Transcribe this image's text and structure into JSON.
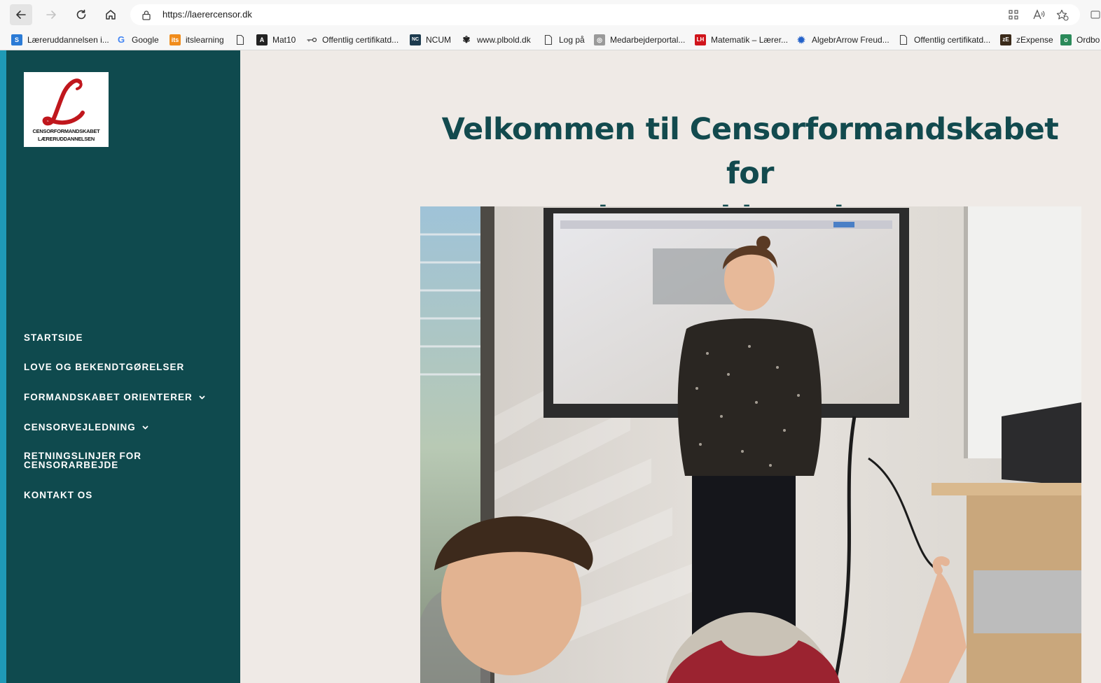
{
  "browser": {
    "url": "https://laerercensor.dk",
    "bookmarks": [
      {
        "label": "Læreruddannelsen i...",
        "icon": "sharepoint-icon"
      },
      {
        "label": "Google",
        "icon": "google-icon"
      },
      {
        "label": "itslearning",
        "icon": "itslearning-icon"
      },
      {
        "label": "",
        "icon": "page-icon"
      },
      {
        "label": "Mat10",
        "icon": "mat10-icon"
      },
      {
        "label": "Offentlig certifikatd...",
        "icon": "key-icon"
      },
      {
        "label": "NCUM",
        "icon": "ncum-icon"
      },
      {
        "label": "www.plbold.dk",
        "icon": "plbold-icon"
      },
      {
        "label": "Log på",
        "icon": "page-icon"
      },
      {
        "label": "Medarbejderportal...",
        "icon": "portal-icon"
      },
      {
        "label": "Matematik – Lærer...",
        "icon": "matematik-icon"
      },
      {
        "label": "AlgebrArrow Freud...",
        "icon": "gear-icon"
      },
      {
        "label": "Offentlig certifikatd...",
        "icon": "page-icon"
      },
      {
        "label": "zExpense",
        "icon": "zexpense-icon"
      },
      {
        "label": "Ordbo",
        "icon": "ordbog-icon"
      }
    ]
  },
  "logo": {
    "line1": "CENSORFORMANDSKABET",
    "line2": "LÆRERUDDANNELSEN"
  },
  "menu": {
    "startside": "STARTSIDE",
    "love": "LOVE OG BEKENDTGØRELSER",
    "formandskabet": "FORMANDSKABET ORIENTERER",
    "censorvejledning": "CENSORVEJLEDNING",
    "retningslinjer_1": "RETNINGSLINJER FOR",
    "retningslinjer_2": "CENSORARBEJDE",
    "kontakt": "KONTAKT OS"
  },
  "main": {
    "title_line1": "Velkommen til Censorformandskabet for",
    "title_line2": "læreruddannelsen"
  },
  "colors": {
    "sidebar": "#0f4a4e",
    "accent_edge": "#1f9ab7",
    "title": "#124a4e",
    "page_bg": "#efeae6"
  }
}
